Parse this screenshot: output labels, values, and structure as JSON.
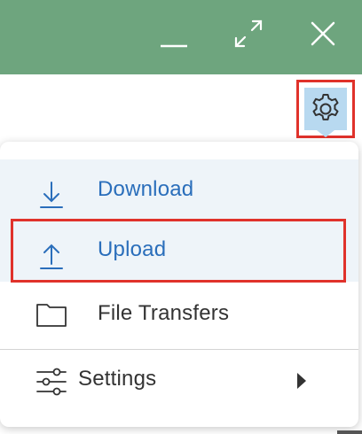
{
  "window": {
    "titlebar_color": "#6ea57e",
    "controls": [
      {
        "name": "minimize-icon"
      },
      {
        "name": "maximize-icon"
      },
      {
        "name": "close-icon"
      }
    ]
  },
  "toolbar": {
    "settings_icon": "gear-icon",
    "highlight_color": "#e0322b"
  },
  "menu": {
    "items": [
      {
        "label": "Download",
        "icon": "download-icon",
        "color": "#2a6ebb"
      },
      {
        "label": "Upload",
        "icon": "upload-icon",
        "color": "#2a6ebb"
      },
      {
        "label": "File Transfers",
        "icon": "folder-icon",
        "color": "#333333"
      },
      {
        "label": "Settings",
        "icon": "sliders-icon",
        "submenu": true,
        "color": "#333333"
      }
    ]
  }
}
